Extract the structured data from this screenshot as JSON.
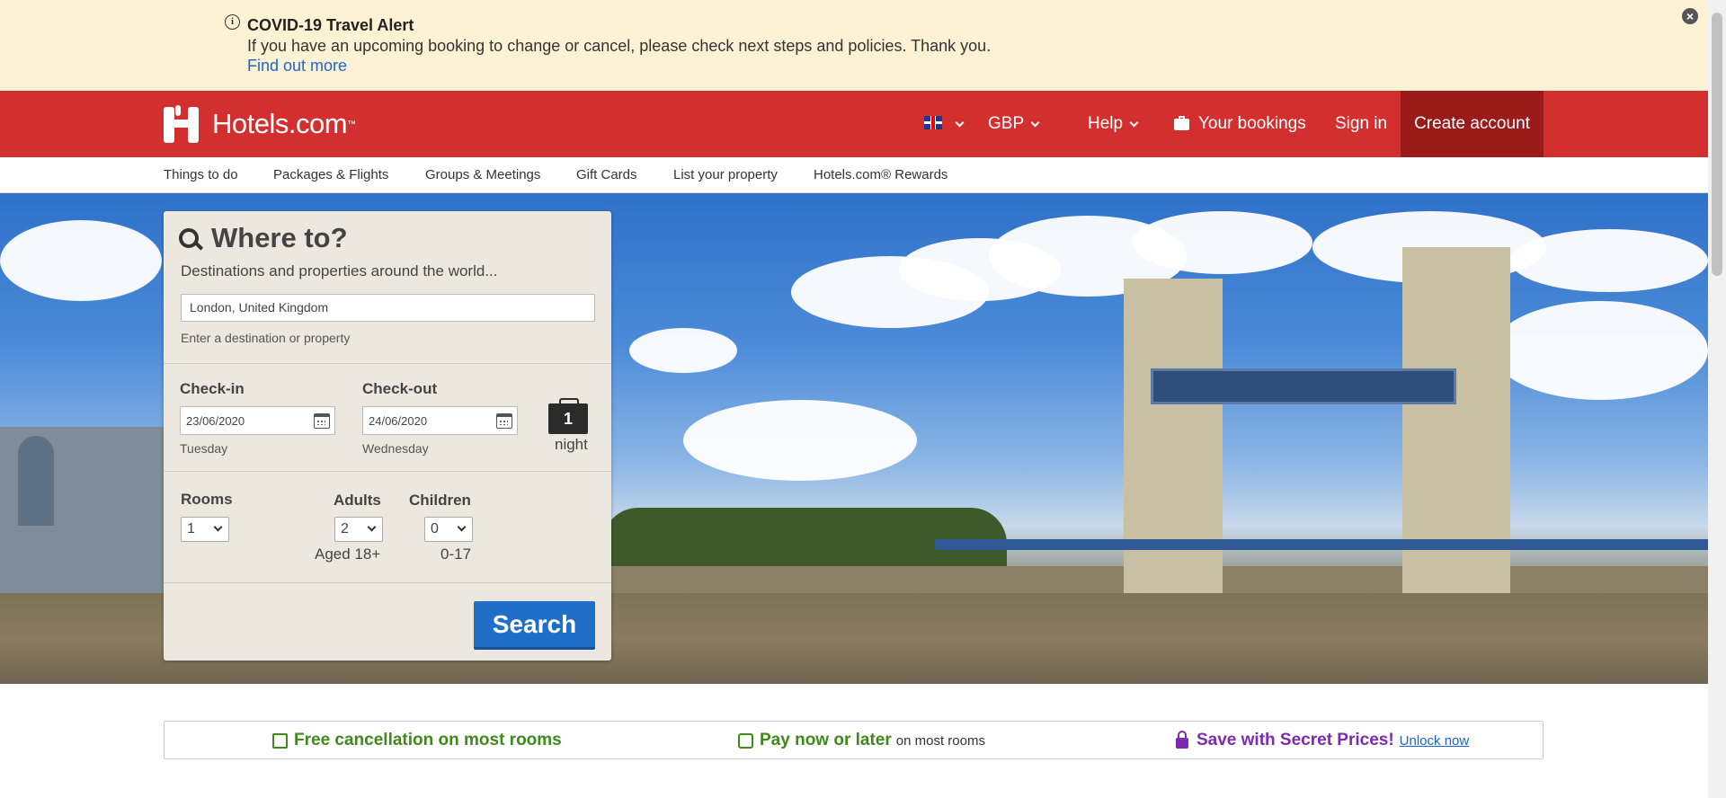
{
  "alert": {
    "title": "COVID-19 Travel Alert",
    "message": "If you have an upcoming booking to change or cancel, please check next steps and policies. Thank you.",
    "link": "Find out more"
  },
  "header": {
    "logo_text": "Hotels.com",
    "logo_tm": "™",
    "currency": "GBP",
    "help": "Help",
    "bookings": "Your bookings",
    "sign_in": "Sign in",
    "create_account": "Create account",
    "brand_color": "#d32f2f"
  },
  "subnav": [
    "Things to do",
    "Packages & Flights",
    "Groups & Meetings",
    "Gift Cards",
    "List your property",
    "Hotels.com® Rewards"
  ],
  "search": {
    "title": "Where to?",
    "subtitle": "Destinations and properties around the world...",
    "destination_value": "London, United Kingdom",
    "hint": "Enter a destination or property",
    "checkin_label": "Check-in",
    "checkin_value": "23/06/2020",
    "checkin_day": "Tuesday",
    "checkout_label": "Check-out",
    "checkout_value": "24/06/2020",
    "checkout_day": "Wednesday",
    "nights_count": "1",
    "nights_label": "night",
    "rooms_label": "Rooms",
    "rooms_value": "1",
    "adults_label": "Adults",
    "adults_value": "2",
    "adults_age": "Aged 18+",
    "children_label": "Children",
    "children_value": "0",
    "children_age": "0-17",
    "button": "Search"
  },
  "benefits": {
    "free_cancel": "Free cancellation on most rooms",
    "pay_later": "Pay now or later",
    "pay_later_suffix": "on most rooms",
    "secret": "Save with Secret Prices!",
    "unlock": "Unlock now"
  },
  "colors": {
    "green": "#3e8a1b",
    "purple": "#7b2bb0",
    "link": "#1a66cc"
  }
}
